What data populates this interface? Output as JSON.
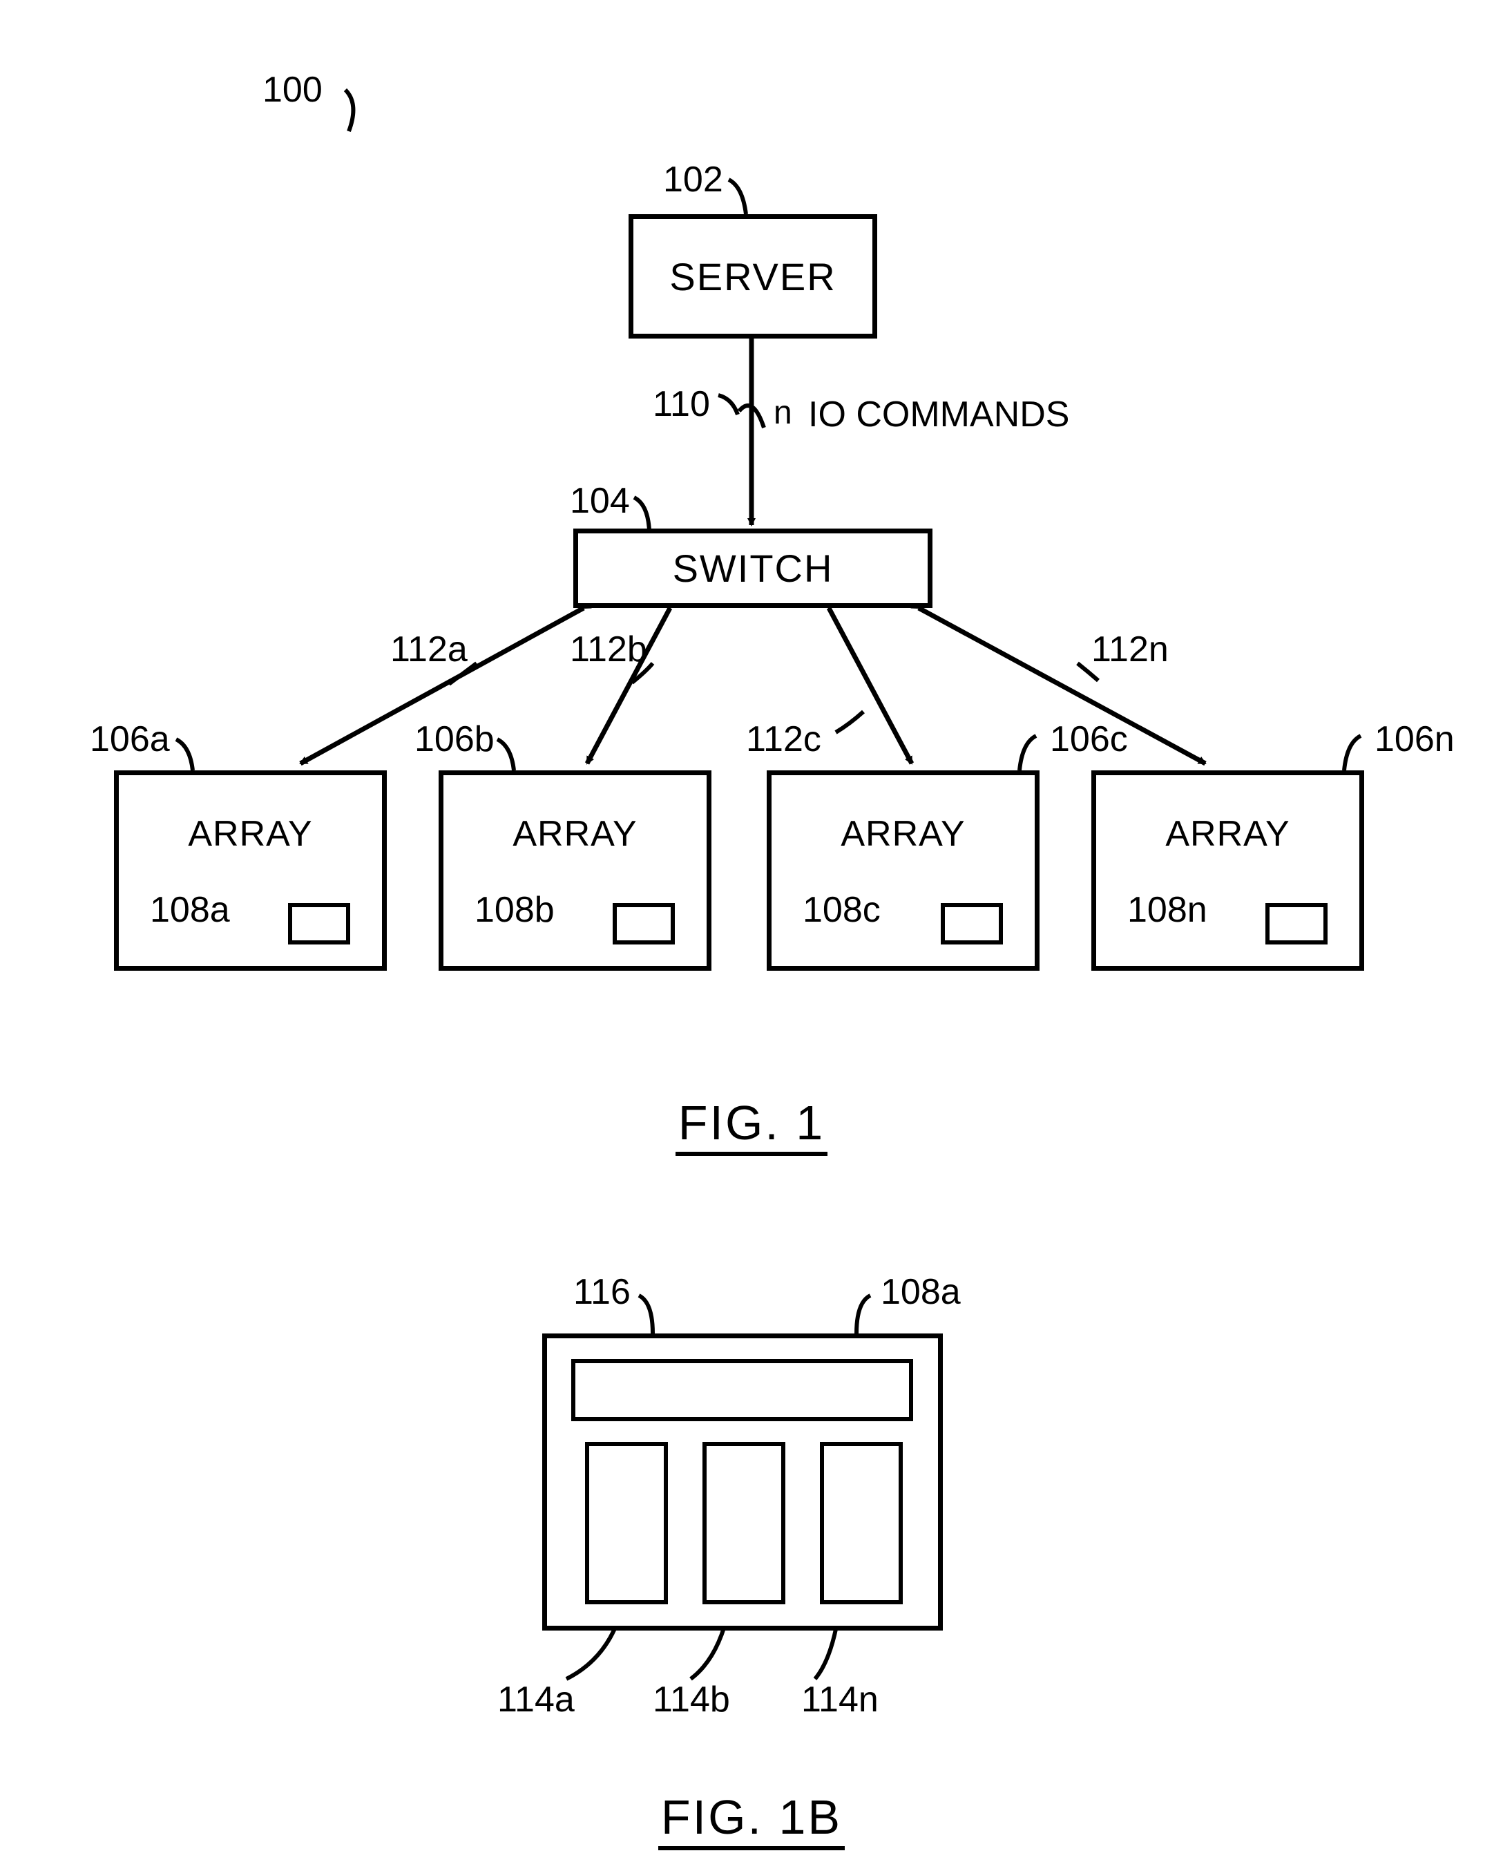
{
  "fig1": {
    "ref_system": "100",
    "server": {
      "label": "SERVER",
      "ref": "102"
    },
    "switch": {
      "label": "SWITCH",
      "ref": "104"
    },
    "link_server_switch": {
      "ref": "110",
      "n_label": "n",
      "note": "IO COMMANDS"
    },
    "links_switch_arrays": {
      "a": "112a",
      "b": "112b",
      "c": "112c",
      "n": "112n"
    },
    "arrays": {
      "a": {
        "label": "ARRAY",
        "ref": "106a",
        "inner_ref": "108a"
      },
      "b": {
        "label": "ARRAY",
        "ref": "106b",
        "inner_ref": "108b"
      },
      "c": {
        "label": "ARRAY",
        "ref": "106c",
        "inner_ref": "108c"
      },
      "n": {
        "label": "ARRAY",
        "ref": "106n",
        "inner_ref": "108n"
      }
    },
    "title": "FIG. 1"
  },
  "fig1b": {
    "outer_ref": "108a",
    "top_bar_ref": "116",
    "columns": {
      "a": "114a",
      "b": "114b",
      "n": "114n"
    },
    "title": "FIG. 1B"
  }
}
